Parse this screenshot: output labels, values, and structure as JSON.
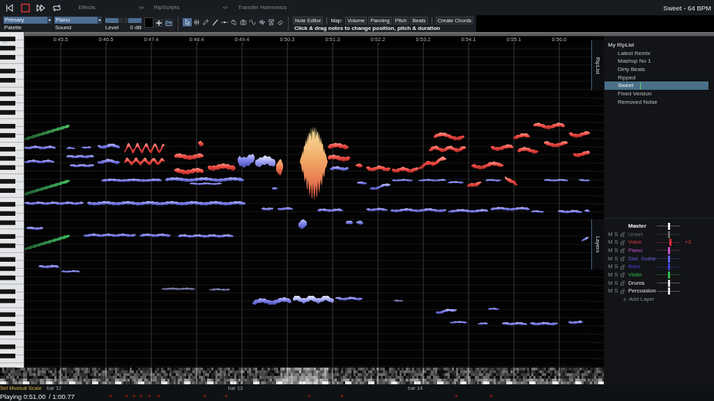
{
  "top_bar": {
    "tabs": [
      {
        "label": "Effects",
        "selected": false,
        "visibility_toggle": false
      },
      {
        "label": "RipScripts",
        "selected": false,
        "visibility_toggle": true
      },
      {
        "label": "Transfer Harmonics",
        "selected": false,
        "visibility_toggle": true
      }
    ],
    "title": "Sweet - 64 BPM"
  },
  "toolbar": {
    "palette": {
      "value": "Primary",
      "label": "Palette"
    },
    "sound": {
      "value": "Piano",
      "label": "Sound"
    },
    "level": {
      "label": "Level",
      "reading": "0 dB",
      "level": 0.5
    },
    "tools": [
      {
        "selected": true
      },
      {
        "selected": false
      },
      {
        "selected": false
      },
      {
        "selected": false
      },
      {
        "selected": false
      },
      {
        "selected": false
      },
      {
        "selected": false
      },
      {
        "selected": false
      },
      {
        "selected": false
      },
      {
        "selected": false
      },
      {
        "selected": false
      }
    ]
  },
  "note_editor": {
    "button": "Note Editor",
    "map_label": "Map:",
    "map_buttons": [
      {
        "label": "Volume",
        "selected": false
      },
      {
        "label": "Panning",
        "selected": false
      },
      {
        "label": "Pitch",
        "selected": false
      },
      {
        "label": "Beats",
        "selected": false
      }
    ],
    "chords_button": "Create Chords",
    "hint": "Click & drag notes to change position, pitch & duration"
  },
  "ruler": {
    "labels": [
      "0:45.5",
      "0:46.5",
      "0:47.4",
      "0:48.4",
      "0:49.4",
      "0:50.3",
      "0:51.3",
      "0:52.2",
      "0:53.2",
      "0:54.1",
      "0:55.1",
      "0:56.0"
    ]
  },
  "riplist": {
    "tab": "RipList",
    "title": "My RipList",
    "items": [
      {
        "label": "Latest Remix",
        "selected": false,
        "cursor": false
      },
      {
        "label": "Mashup No 1",
        "selected": false,
        "cursor": false
      },
      {
        "label": "Dirty Beats",
        "selected": false,
        "cursor": false
      },
      {
        "label": "Ripped",
        "selected": false,
        "cursor": false
      },
      {
        "label": "Sweet",
        "selected": true,
        "cursor": true
      },
      {
        "label": "Fixed Version",
        "selected": false,
        "cursor": false
      },
      {
        "label": "Removed Noise",
        "selected": false,
        "cursor": false
      }
    ]
  },
  "layers": {
    "tab": "Layers",
    "rows": [
      {
        "kind": "master",
        "name": "Master",
        "color": "#f2f2f2",
        "level": 0.5
      },
      {
        "kind": "layer",
        "mute": "M",
        "solo": "S",
        "name": "Unset",
        "color": "#6b6b6b",
        "level": 0.5
      },
      {
        "kind": "layer",
        "mute": "M",
        "solo": "S",
        "name": "Voice",
        "color": "#e5323c",
        "level": 0.58,
        "gain": "+3"
      },
      {
        "kind": "layer",
        "mute": "M",
        "solo": "S",
        "name": "Piano",
        "color": "#cf4fcf",
        "level": 0.5
      },
      {
        "kind": "layer",
        "mute": "M",
        "solo": "S",
        "name": "Dist. Guitar",
        "color": "#6565e6",
        "level": 0.5
      },
      {
        "kind": "layer",
        "mute": "M",
        "solo": "S",
        "name": "Bass",
        "color": "#4343d6",
        "level": 0.5
      },
      {
        "kind": "layer",
        "mute": "M",
        "solo": "S",
        "name": "Violin",
        "color": "#2fc24a",
        "level": 0.5
      },
      {
        "kind": "layer",
        "mute": "M",
        "solo": "S",
        "name": "Drums",
        "color": "#e6e6e6",
        "level": 0.5
      },
      {
        "kind": "layer",
        "mute": "M",
        "solo": "S",
        "name": "Percussion",
        "color": "#e6e6e6",
        "level": 0.5
      }
    ],
    "add_label": "Add Layer"
  },
  "bottom_bar": {
    "scale_button": "Set Musical Scale",
    "bars": [
      "bar 12",
      "bar 13",
      "bar 14"
    ],
    "status": "Playing 0:51.00",
    "total": "/ 1:00.77"
  }
}
